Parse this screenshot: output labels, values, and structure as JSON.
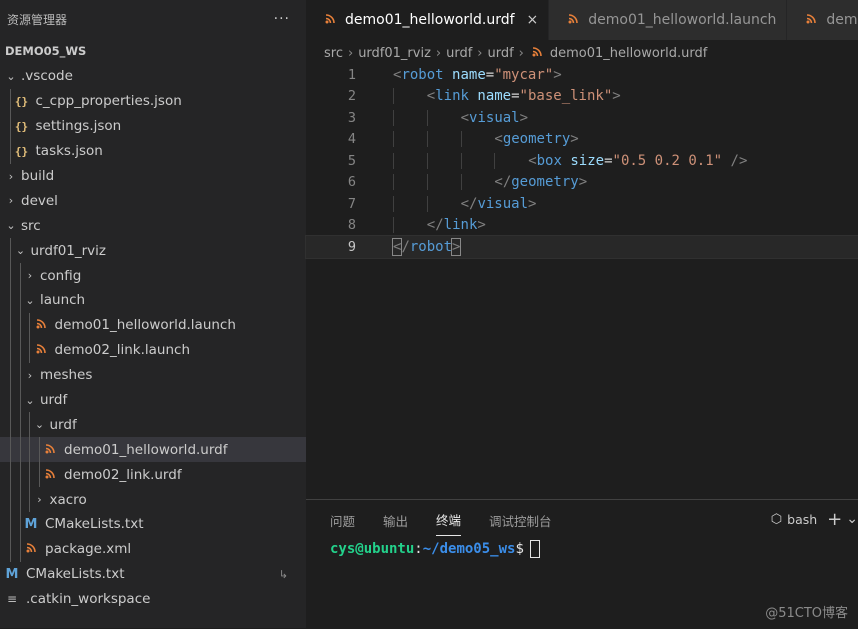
{
  "sidebar": {
    "title": "资源管理器",
    "more_icon": "ellipsis-icon",
    "more_label": "···",
    "section_title": "DEMO05_WS",
    "tree": [
      {
        "label": ".vscode",
        "depth": 0,
        "kind": "folder",
        "expanded": true
      },
      {
        "label": "c_cpp_properties.json",
        "depth": 1,
        "kind": "json",
        "icon": "{}"
      },
      {
        "label": "settings.json",
        "depth": 1,
        "kind": "json",
        "icon": "{}"
      },
      {
        "label": "tasks.json",
        "depth": 1,
        "kind": "json",
        "icon": "{}"
      },
      {
        "label": "build",
        "depth": 0,
        "kind": "folder",
        "expanded": false
      },
      {
        "label": "devel",
        "depth": 0,
        "kind": "folder",
        "expanded": false
      },
      {
        "label": "src",
        "depth": 0,
        "kind": "folder",
        "expanded": true
      },
      {
        "label": "urdf01_rviz",
        "depth": 1,
        "kind": "folder",
        "expanded": true
      },
      {
        "label": "config",
        "depth": 2,
        "kind": "folder",
        "expanded": false
      },
      {
        "label": "launch",
        "depth": 2,
        "kind": "folder",
        "expanded": true
      },
      {
        "label": "demo01_helloworld.launch",
        "depth": 3,
        "kind": "rss",
        "icon": "ᵔ"
      },
      {
        "label": "demo02_link.launch",
        "depth": 3,
        "kind": "rss",
        "icon": "ᵔ"
      },
      {
        "label": "meshes",
        "depth": 2,
        "kind": "folder",
        "expanded": false
      },
      {
        "label": "urdf",
        "depth": 2,
        "kind": "folder",
        "expanded": true
      },
      {
        "label": "urdf",
        "depth": 3,
        "kind": "folder",
        "expanded": true
      },
      {
        "label": "demo01_helloworld.urdf",
        "depth": 4,
        "kind": "rss",
        "icon": "ᵔ",
        "selected": true
      },
      {
        "label": "demo02_link.urdf",
        "depth": 4,
        "kind": "rss",
        "icon": "ᵔ"
      },
      {
        "label": "xacro",
        "depth": 3,
        "kind": "folder",
        "expanded": false
      },
      {
        "label": "CMakeLists.txt",
        "depth": 2,
        "kind": "cmake",
        "icon": "M"
      },
      {
        "label": "package.xml",
        "depth": 2,
        "kind": "rss",
        "icon": "ᵔ"
      },
      {
        "label": "CMakeLists.txt",
        "depth": 0,
        "kind": "cmake",
        "icon": "M",
        "extra": "↳"
      },
      {
        "label": ".catkin_workspace",
        "depth": 0,
        "kind": "file",
        "icon": "≡"
      }
    ]
  },
  "editor": {
    "tabs": [
      {
        "label": "demo01_helloworld.urdf",
        "active": true,
        "icon": "rss-icon",
        "close": "×"
      },
      {
        "label": "demo01_helloworld.launch",
        "active": false,
        "icon": "rss-icon"
      },
      {
        "label": "demo",
        "active": false,
        "icon": "rss-icon"
      }
    ],
    "breadcrumb": [
      "src",
      "urdf01_rviz",
      "urdf",
      "urdf",
      "demo01_helloworld.urdf"
    ],
    "breadcrumb_sep": "›",
    "current_line": 9,
    "lines": [
      {
        "n": "1",
        "indent": 0,
        "tokens": [
          [
            "t-punct",
            "<"
          ],
          [
            "t-tag",
            "robot"
          ],
          [
            "t-text",
            " "
          ],
          [
            "t-attr",
            "name"
          ],
          [
            "t-eq",
            "="
          ],
          [
            "t-str",
            "\"mycar\""
          ],
          [
            "t-punct",
            ">"
          ]
        ]
      },
      {
        "n": "2",
        "indent": 1,
        "tokens": [
          [
            "t-punct",
            "<"
          ],
          [
            "t-tag",
            "link"
          ],
          [
            "t-text",
            " "
          ],
          [
            "t-attr",
            "name"
          ],
          [
            "t-eq",
            "="
          ],
          [
            "t-str",
            "\"base_link\""
          ],
          [
            "t-punct",
            ">"
          ]
        ]
      },
      {
        "n": "3",
        "indent": 2,
        "tokens": [
          [
            "t-punct",
            "<"
          ],
          [
            "t-tag",
            "visual"
          ],
          [
            "t-punct",
            ">"
          ]
        ]
      },
      {
        "n": "4",
        "indent": 3,
        "tokens": [
          [
            "t-punct",
            "<"
          ],
          [
            "t-tag",
            "geometry"
          ],
          [
            "t-punct",
            ">"
          ]
        ]
      },
      {
        "n": "5",
        "indent": 4,
        "tokens": [
          [
            "t-punct",
            "<"
          ],
          [
            "t-tag",
            "box"
          ],
          [
            "t-text",
            " "
          ],
          [
            "t-attr",
            "size"
          ],
          [
            "t-eq",
            "="
          ],
          [
            "t-str",
            "\"0.5 0.2 0.1\""
          ],
          [
            "t-text",
            " "
          ],
          [
            "t-punct",
            "/>"
          ]
        ]
      },
      {
        "n": "6",
        "indent": 3,
        "tokens": [
          [
            "t-punct",
            "</"
          ],
          [
            "t-tag",
            "geometry"
          ],
          [
            "t-punct",
            ">"
          ]
        ]
      },
      {
        "n": "7",
        "indent": 2,
        "tokens": [
          [
            "t-punct",
            "</"
          ],
          [
            "t-tag",
            "visual"
          ],
          [
            "t-punct",
            ">"
          ]
        ]
      },
      {
        "n": "8",
        "indent": 1,
        "tokens": [
          [
            "t-punct",
            "</"
          ],
          [
            "t-tag",
            "link"
          ],
          [
            "t-punct",
            ">"
          ]
        ]
      },
      {
        "n": "9",
        "indent": 0,
        "tokens": [
          [
            "t-punct",
            "<"
          ],
          [
            "t-punct",
            "/"
          ],
          [
            "t-tag",
            "robot"
          ],
          [
            "t-punct",
            ">"
          ]
        ]
      }
    ]
  },
  "panel": {
    "tabs": [
      {
        "label": "问题",
        "active": false
      },
      {
        "label": "输出",
        "active": false
      },
      {
        "label": "终端",
        "active": true
      },
      {
        "label": "调试控制台",
        "active": false
      }
    ],
    "shell_label": "bash",
    "add_label": "+",
    "more_label": "⌄",
    "prompt": {
      "user": "cys@ubuntu",
      "sep": ":",
      "path": "~/demo05_ws",
      "dollar": "$"
    }
  },
  "watermark": "@51CTO博客",
  "colors": {
    "accent_user": "#23d18b",
    "accent_path": "#3b8eea",
    "file_icon": "#e8803a",
    "cmake_icon": "#5fa3d8"
  }
}
